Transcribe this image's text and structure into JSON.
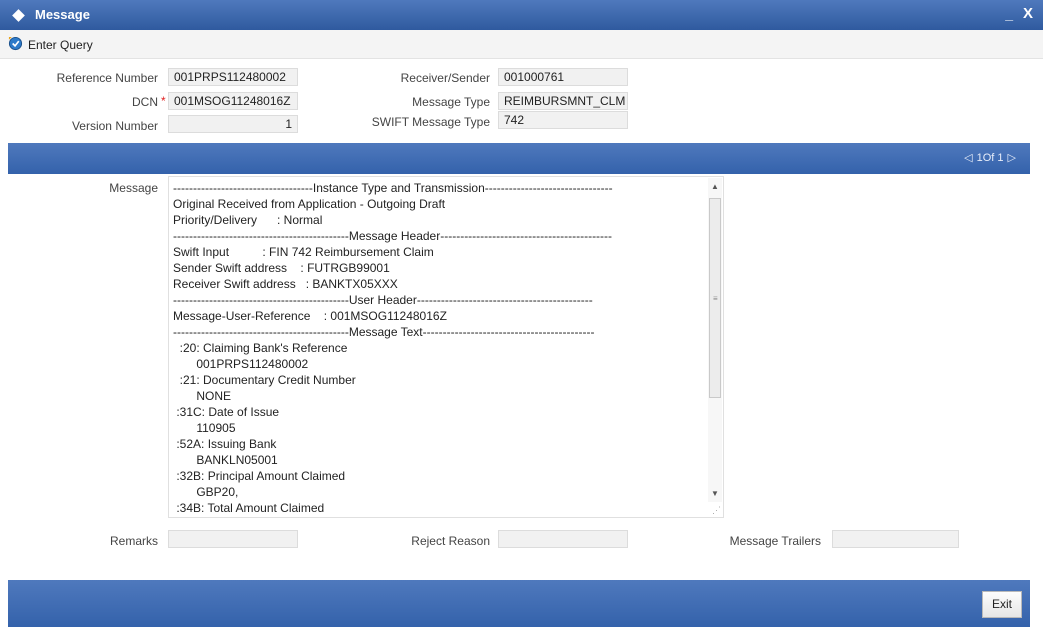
{
  "window": {
    "title": "Message",
    "minimize": "_",
    "close": "X"
  },
  "toolbar": {
    "enter_query": "Enter Query"
  },
  "form": {
    "reference_number_label": "Reference Number",
    "reference_number": "001PRPS112480002",
    "dcn_label": "DCN",
    "dcn_required": "*",
    "dcn": "001MSOG11248016Z",
    "version_number_label": "Version Number",
    "version_number": "1",
    "receiver_sender_label": "Receiver/Sender",
    "receiver_sender": "001000761",
    "message_type_label": "Message Type",
    "message_type": "REIMBURSMNT_CLM",
    "swift_message_type_label": "SWIFT Message Type",
    "swift_message_type": "742"
  },
  "pager": {
    "prev": "◁",
    "text": "1Of 1",
    "next": "▷"
  },
  "message": {
    "label": "Message",
    "text": "-----------------------------------Instance Type and Transmission--------------------------------\nOriginal Received from Application - Outgoing Draft\nPriority/Delivery      : Normal\n--------------------------------------------Message Header-------------------------------------------\nSwift Input          : FIN 742 Reimbursement Claim\nSender Swift address    : FUTRGB99001\nReceiver Swift address   : BANKTX05XXX\n--------------------------------------------User Header--------------------------------------------\nMessage-User-Reference    : 001MSOG11248016Z\n--------------------------------------------Message Text-------------------------------------------\n  :20: Claiming Bank's Reference\n       001PRPS112480002\n  :21: Documentary Credit Number\n       NONE\n :31C: Date of Issue\n       110905\n :52A: Issuing Bank\n       BANKLN05001\n :32B: Principal Amount Claimed\n       GBP20,\n :34B: Total Amount Claimed"
  },
  "footer": {
    "remarks_label": "Remarks",
    "remarks": "",
    "reject_reason_label": "Reject Reason",
    "reject_reason": "",
    "message_trailers_label": "Message Trailers",
    "message_trailers": "",
    "exit_label": "Exit"
  },
  "colors": {
    "accent": "#3462ab",
    "title_bar": "#2f5a9f",
    "required": "#e02020"
  },
  "icons": {
    "enter_query": "enter-query-icon",
    "window": "diamond-icon"
  }
}
